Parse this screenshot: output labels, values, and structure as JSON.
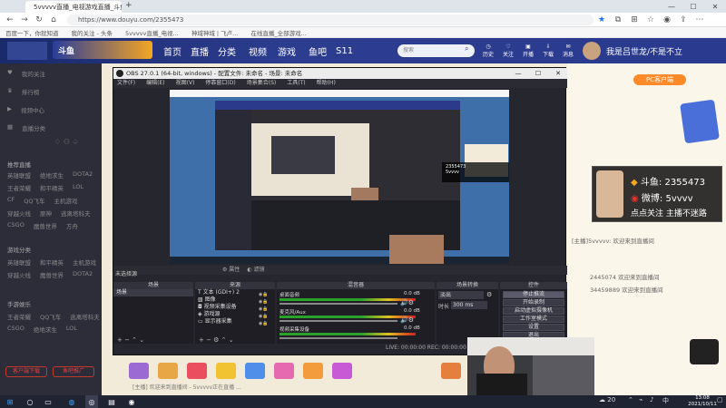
{
  "browser": {
    "tab1": "5vvvvv直播_电视游戏直播_斗鱼直播",
    "tab_add": "+",
    "url": "https://www.douyu.com/2355473",
    "bookmarks": [
      "百度一下，你就知道",
      "我的关注 - 头条",
      "5vvvvv直播_电视...",
      "神域神域 | 飞卢...",
      "在线直播_全部游戏..."
    ]
  },
  "site": {
    "logo": "斗鱼",
    "nav": [
      "首页",
      "直播",
      "分类",
      "视频",
      "游戏",
      "鱼吧",
      "S11"
    ],
    "search_placeholder": "搜索",
    "header_icons": [
      "历史",
      "关注",
      "开播",
      "下载",
      "消息"
    ],
    "username": "我是吕世龙/不是不立"
  },
  "sidebar": {
    "top": [
      "我的关注",
      "排行榜",
      "视频中心",
      "直播分类"
    ],
    "sections": [
      "推荐直播",
      "游戏分类",
      "手游娱乐"
    ],
    "rows": [
      [
        "英雄联盟",
        "绝地求生",
        "DOTA2"
      ],
      [
        "王者荣耀",
        "和平精英",
        "LOL"
      ],
      [
        "CF",
        "QQ飞车",
        "主机游戏"
      ],
      [
        "穿越火线",
        "原神",
        "逃离塔科夫"
      ],
      [
        "CSGO",
        "魔兽世界",
        "方舟"
      ]
    ],
    "buttons": [
      "客户端下载",
      "鱼吧推广"
    ]
  },
  "obs": {
    "title": "OBS 27.0.1 (64-bit, windows) - 配置文件: 未命名 - 场景: 未命名",
    "menu": [
      "文件(F)",
      "编辑(E)",
      "视图(V)",
      "停靠窗口(D)",
      "场景集合(S)",
      "工具(T)",
      "帮助(H)"
    ],
    "preview_toggles": [
      "属性",
      "滤镜"
    ],
    "scene_label": "未选择源",
    "docks": [
      "场景",
      "来源",
      "混音器",
      "场景转换",
      "控件"
    ],
    "scenes": [
      "场景"
    ],
    "sources": [
      "文本 (GDI+) 2",
      "图像",
      "视频采集设备",
      "游戏源",
      "显示器采集"
    ],
    "mixer": [
      {
        "name": "桌面音频",
        "db": "0.0 dB"
      },
      {
        "name": "麦克风/Aux",
        "db": "0.0 dB"
      },
      {
        "name": "视频采集设备",
        "db": "0.0 dB"
      }
    ],
    "transition": "淡出",
    "duration_label": "时长",
    "duration": "300 ms",
    "controls": [
      "停止推流",
      "开始录制",
      "启动虚拟摄像机",
      "工作室模式",
      "设置",
      "退出"
    ],
    "status": "LIVE: 00:00:00   REC: 00:00:00   CPU: 12.5%, 30.00 fps"
  },
  "overlay": {
    "room_label": "斗鱼:",
    "room_id": "2355473",
    "weibo_label": "微博:",
    "weibo": "5vvvv",
    "follow": "点点关注 主播不迷路"
  },
  "chat": [
    "[主播]5vvvvv: 欢迎来到直播间",
    "2445074 欢迎来到直播间",
    "34459889 欢迎来到直播间"
  ],
  "page": {
    "pc_banner": "PC客户端",
    "caption": "[主播] 欢迎来到直播间 - 5vvvvv正在直播 ..."
  },
  "taskbar": {
    "time": "13:08",
    "date": "2021/10/11",
    "temp": "20",
    "lang": "中"
  }
}
